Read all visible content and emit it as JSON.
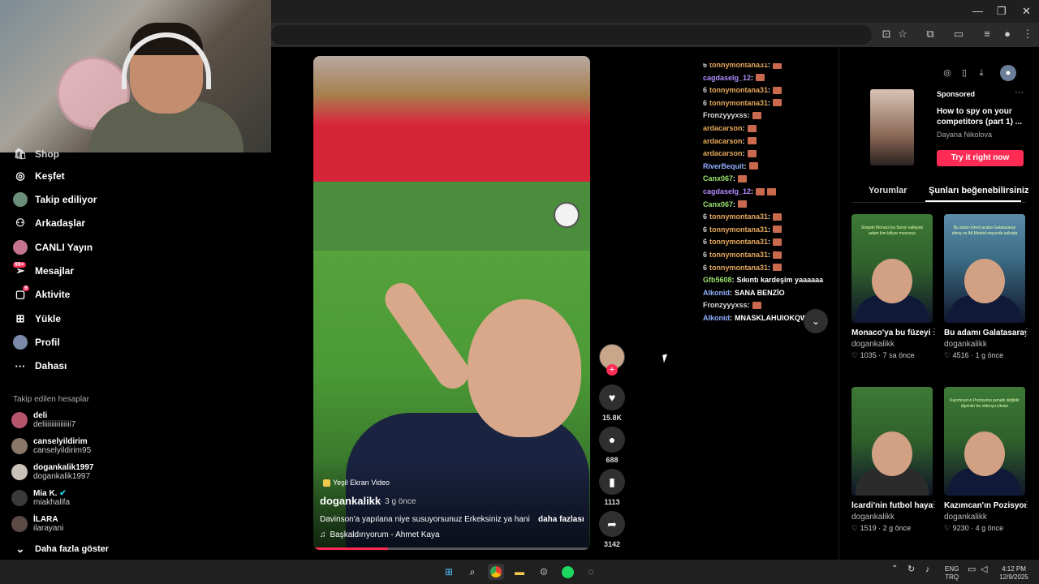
{
  "browser": {
    "window_controls": {
      "minimize": "—",
      "restore": "❐",
      "close": "✕"
    }
  },
  "sidebar": {
    "items": [
      {
        "label": "Shop",
        "icon": "shop-icon"
      },
      {
        "label": "Keşfet",
        "icon": "compass-icon"
      },
      {
        "label": "Takip ediliyor",
        "icon": "following-avatar-icon"
      },
      {
        "label": "Arkadaşlar",
        "icon": "friends-icon"
      },
      {
        "label": "CANLI Yayın",
        "icon": "live-icon"
      },
      {
        "label": "Mesajlar",
        "icon": "messages-icon",
        "badge": "99+"
      },
      {
        "label": "Aktivite",
        "icon": "activity-icon",
        "badge": "9"
      },
      {
        "label": "Yükle",
        "icon": "upload-icon"
      },
      {
        "label": "Profil",
        "icon": "profile-avatar-icon"
      },
      {
        "label": "Dahası",
        "icon": "more-icon"
      }
    ],
    "following_header": "Takip edilen hesaplar",
    "following": [
      {
        "name": "deli",
        "handle": "deliiiiiiiiiiiiiii7"
      },
      {
        "name": "canselyildirim",
        "handle": "canselyildirim95"
      },
      {
        "name": "dogankalik1997",
        "handle": "dogankalik1997"
      },
      {
        "name": "Mia K.",
        "handle": "miakhalifa",
        "verified": true
      },
      {
        "name": "İLARA",
        "handle": "ilarayani"
      }
    ],
    "show_more": "Daha fazla göster"
  },
  "video": {
    "tag": "Yeşil Ekran Video",
    "author": "dogankalikk",
    "time": "· 3 g önce",
    "description": "Davinson'a yapılana niye susuyorsunuz Erkeksiniz ya hani",
    "more": "daha fazlası",
    "music": "Başkaldırıyorum - Ahmet Kaya",
    "progress": 0.27
  },
  "actions": {
    "likes": "15.8K",
    "comments": "688",
    "saves": "1113",
    "shares": "3142"
  },
  "chat": [
    {
      "user": "tonnymontana31",
      "color": "#e6a85c",
      "emotes": 1,
      "prefix": "6"
    },
    {
      "user": "cagdaselg_12",
      "color": "#b38cff",
      "emotes": 1
    },
    {
      "user": "tonnymontana31",
      "color": "#e6a85c",
      "emotes": 1,
      "prefix": "6"
    },
    {
      "user": "tonnymontana31",
      "color": "#e6a85c",
      "emotes": 1,
      "prefix": "6"
    },
    {
      "user": "Fronzyyyxss",
      "color": "#dddddd",
      "emotes": 1
    },
    {
      "user": "ardacarson",
      "color": "#e6a85c",
      "emotes": 1
    },
    {
      "user": "ardacarson",
      "color": "#e6a85c",
      "emotes": 1
    },
    {
      "user": "ardacarson",
      "color": "#e6a85c",
      "emotes": 1
    },
    {
      "user": "RiverBequit",
      "color": "#8fb0ff",
      "emotes": 1
    },
    {
      "user": "Canx067",
      "color": "#9be36f",
      "emotes": 1
    },
    {
      "user": "cagdaselg_12",
      "color": "#b38cff",
      "emotes": 2
    },
    {
      "user": "Canx067",
      "color": "#9be36f",
      "emotes": 1
    },
    {
      "user": "tonnymontana31",
      "color": "#e6a85c",
      "emotes": 1,
      "prefix": "6"
    },
    {
      "user": "tonnymontana31",
      "color": "#e6a85c",
      "emotes": 1,
      "prefix": "6"
    },
    {
      "user": "tonnymontana31",
      "color": "#e6a85c",
      "emotes": 1,
      "prefix": "6"
    },
    {
      "user": "tonnymontana31",
      "color": "#e6a85c",
      "emotes": 1,
      "prefix": "6"
    },
    {
      "user": "tonnymontana31",
      "color": "#e6a85c",
      "emotes": 1,
      "prefix": "6"
    },
    {
      "user": "Gfb5608",
      "color": "#9be36f",
      "text": "Sıkıntı kardeşim yaaaaaa"
    },
    {
      "user": "Alkonid",
      "color": "#8fb0ff",
      "text": "SANA BENZİO"
    },
    {
      "user": "Fronzyyyxss",
      "color": "#dddddd",
      "emotes": 1
    },
    {
      "user": "Alkonid",
      "color": "#8fb0ff",
      "text": "MNASKLAHUIOKQWE"
    }
  ],
  "ad": {
    "label": "Sponsored",
    "title": "How to spy on your competitors (part 1) ...",
    "author": "Dayana Nikolova",
    "cta": "Try it right now"
  },
  "right_tabs": [
    "Yorumlar",
    "Şunları beğenebilirsiniz"
  ],
  "cards": [
    {
      "title": "Monaco'ya bu füzeyi sallayan ki...",
      "author": "dogankalikk",
      "likes": "1035",
      "time": "7 sa önce",
      "caption": "Sürgeki Monaco'ya füzeyi sallayan adam kim biliyor musunuz"
    },
    {
      "title": "Bu adamı Galatasaray almı...",
      "author": "dogankalikk",
      "likes": "4516",
      "time": "1 g önce",
      "caption": "Bu adam kimdi acaba Galatasaray almış ve Atl.Madrid maçında sahada"
    },
    {
      "title": "İcardi'nin futbol hayatının bittiği ...",
      "author": "dogankalikk",
      "likes": "1519",
      "time": "2 g önce",
      "caption": ""
    },
    {
      "title": "Kazımcan'ın Pozisyonu penalt...",
      "author": "dogankalikk",
      "likes": "9230",
      "time": "4 g önce",
      "caption": "Kazımcan'ın Pozisyonu penaltı değildir diyenler bu videoyu izlesin"
    }
  ],
  "taskbar": {
    "lang1": "ENG",
    "lang2": "TRQ",
    "time": "4:12 PM",
    "date": "12/9/2025"
  }
}
